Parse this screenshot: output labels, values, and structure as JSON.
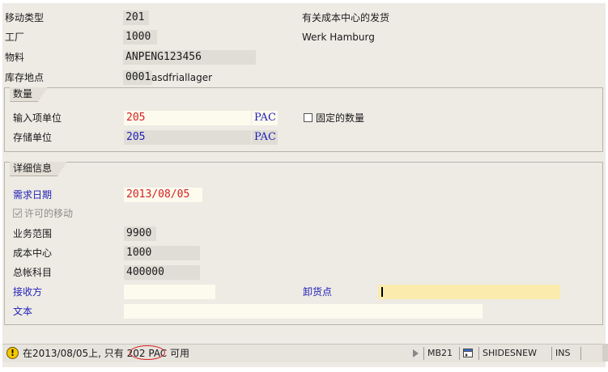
{
  "header": {
    "movement_type": {
      "label": "移动类型",
      "value": "201",
      "description": "有关成本中心的发货"
    },
    "plant": {
      "label": "工厂",
      "value": "1000",
      "description": "Werk Hamburg"
    },
    "material": {
      "label": "物料",
      "value": "ANPENG123456"
    },
    "storage_location": {
      "label": "库存地点",
      "code": "0001",
      "name": "asdfriallager"
    }
  },
  "quantity": {
    "title": "数量",
    "entry_unit": {
      "label": "输入项单位",
      "value": "205",
      "unit": "PAC"
    },
    "stock_unit": {
      "label": "存储单位",
      "value": "205",
      "unit": "PAC"
    },
    "fixed_qty": {
      "label": "固定的数量",
      "checked": false
    }
  },
  "details": {
    "title": "详细信息",
    "requirement_date": {
      "label": "需求日期",
      "value": "2013/08/05"
    },
    "allowed_movement": {
      "label": "许可的移动",
      "checked": true
    },
    "business_area": {
      "label": "业务范围",
      "value": "9900"
    },
    "cost_center": {
      "label": "成本中心",
      "value": "1000"
    },
    "gl_account": {
      "label": "总帐科目",
      "value": "400000"
    },
    "recipient": {
      "label": "接收方",
      "value": ""
    },
    "unloading_point": {
      "label": "卸货点",
      "value": ""
    },
    "text": {
      "label": "文本",
      "value": ""
    }
  },
  "statusbar": {
    "message_pre": "在2013/08/05上, 只有",
    "message_qty": " 202 ",
    "message_post": "PAC 可用",
    "transaction": "MB21",
    "system": "SHIDESNEW",
    "mode": "INS",
    "colors": {
      "warning": "#f5c800",
      "highlight": "#d62020"
    }
  }
}
